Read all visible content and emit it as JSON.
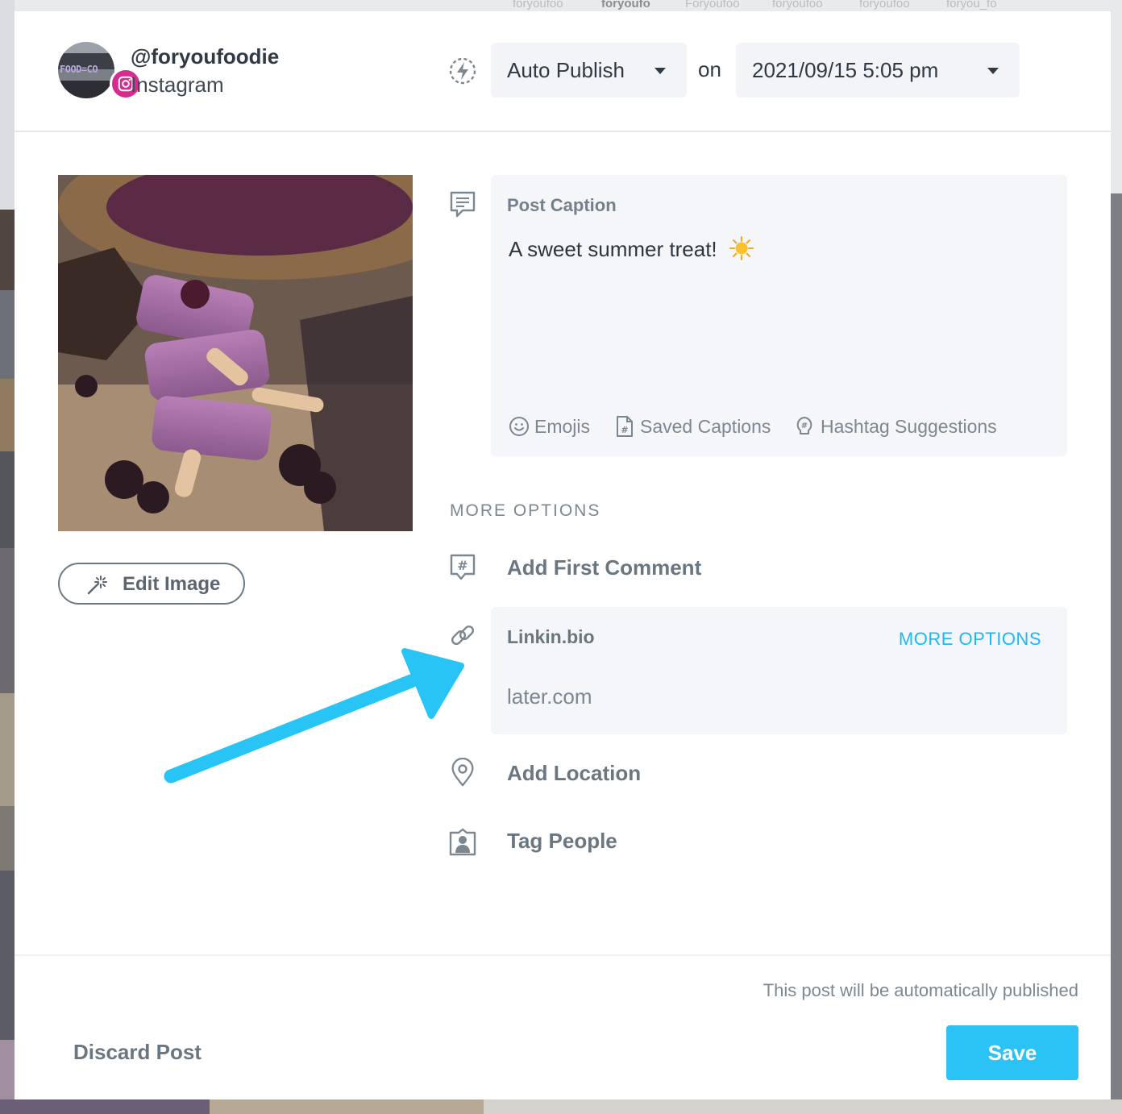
{
  "background": {
    "top_strip_names": [
      "foryoufoo",
      "foryoufo",
      "Foryoufoo",
      "foryoufoo",
      "foryoufoo",
      "foryou_fo"
    ]
  },
  "account": {
    "handle": "@foryoufoodie",
    "network": "Instagram",
    "avatar_text": "FOOD=CO"
  },
  "publish": {
    "mode": "Auto Publish",
    "on_label": "on",
    "datetime": "2021/09/15 5:05 pm"
  },
  "media": {
    "edit_label": "Edit Image"
  },
  "caption": {
    "label": "Post Caption",
    "text": "A sweet summer treat!",
    "emoji": "sun-emoji",
    "tools": {
      "emojis": "Emojis",
      "saved_captions": "Saved Captions",
      "hashtag_suggestions": "Hashtag Suggestions"
    }
  },
  "more_options": {
    "heading": "MORE OPTIONS",
    "first_comment": "Add First Comment",
    "linkin": {
      "label": "Linkin.bio",
      "more_options_link": "MORE OPTIONS",
      "url": "later.com"
    },
    "location": "Add Location",
    "tag_people": "Tag People"
  },
  "footer": {
    "note": "This post will be automatically published",
    "discard": "Discard Post",
    "save": "Save"
  },
  "colors": {
    "accent": "#2bc2f5",
    "link": "#1db7f2",
    "instagram": "#d62c8f",
    "annotation_arrow": "#28c4f6"
  },
  "icons": [
    "auto-publish-icon",
    "caption-icon",
    "first-comment-icon",
    "link-icon",
    "location-pin-icon",
    "tag-people-icon",
    "magic-wand-icon",
    "instagram-icon",
    "emoji-icon",
    "saved-captions-icon",
    "hashtag-suggestions-icon",
    "caret-down-icon"
  ]
}
